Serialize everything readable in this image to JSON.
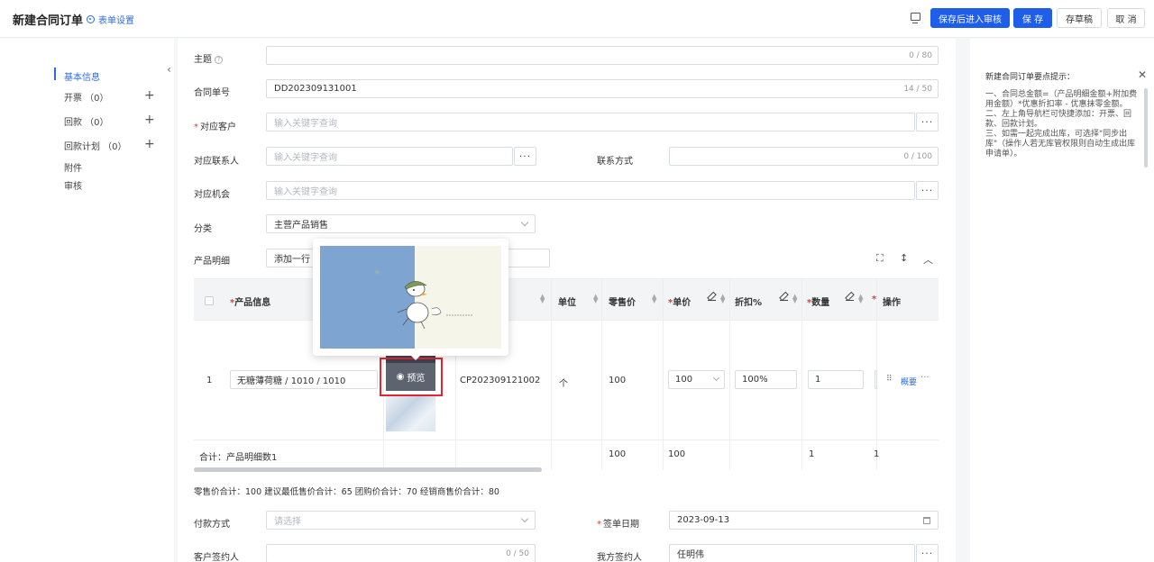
{
  "header": {
    "title": "新建合同订单",
    "form_settings": "表单设置",
    "buttons": {
      "save_submit": "保存后进入审核",
      "save": "保 存",
      "draft": "存草稿",
      "cancel": "取 消"
    }
  },
  "leftnav": {
    "items": [
      {
        "label": "基本信息"
      },
      {
        "label": "开票 （0）"
      },
      {
        "label": "回款 （0）"
      },
      {
        "label": "回款计划 （0）"
      },
      {
        "label": "附件"
      },
      {
        "label": "审核"
      }
    ]
  },
  "form": {
    "subject": {
      "label": "主题",
      "count": "0 / 80"
    },
    "contract_no": {
      "label": "合同单号",
      "value": "DD202309131001",
      "count": "14 / 50"
    },
    "customer": {
      "label": "对应客户",
      "placeholder": "输入关键字查询"
    },
    "contact": {
      "label": "对应联系人",
      "placeholder": "输入关键字查询"
    },
    "contact_method": {
      "label": "联系方式",
      "count": "0 / 100"
    },
    "opportunity": {
      "label": "对应机会",
      "placeholder": "输入关键字查询"
    },
    "category": {
      "label": "分类",
      "value": "主营产品销售"
    },
    "product_detail": {
      "label": "产品明细",
      "add_row": "添加一行"
    }
  },
  "table": {
    "headers": {
      "product_info": "产品信息",
      "unit": "单位",
      "retail_price": "零售价",
      "unit_price": "单价",
      "discount": "折扣%",
      "quantity": "数量",
      "action": "操作"
    },
    "row": {
      "index": "1",
      "product": "无糖薄荷糖 / 1010 / 1010",
      "code": "CP202309121002",
      "unit": "个",
      "retail_price": "100",
      "unit_price": "100",
      "discount": "100%",
      "quantity": "1",
      "action_link": "概要"
    },
    "preview_label": "预览",
    "total": {
      "label": "合计：产品明细数1",
      "retail_price": "100",
      "unit_price": "100",
      "quantity": "1",
      "extra": "1"
    }
  },
  "summary": "零售价合计：100   建议最低售价合计：65   团购价合计：70   经销商售价合计：80",
  "bottom": {
    "payment": {
      "label": "付款方式",
      "placeholder": "请选择"
    },
    "sign_date": {
      "label": "签单日期",
      "value": "2023-09-13"
    },
    "customer_signer": {
      "label": "客户签约人",
      "count": "0 / 50"
    },
    "our_signer": {
      "label": "我方签约人",
      "value": "任明伟"
    }
  },
  "rightpanel": {
    "title": "新建合同订单要点提示：",
    "tips": [
      "一、合同总金额=（产品明细金额+附加费用金额）*优惠折扣率 - 优惠抹零金额。",
      "二、左上角导航栏可快捷添加：开票、回款、回款计划。",
      "三、如需一起完成出库，可选择\"同步出库\"（操作人若无库管权限则自动生成出库申请单）。"
    ]
  },
  "colors": {
    "primary": "#1e5ee8",
    "highlight": "#e3262f",
    "required": "#e23b3b"
  }
}
